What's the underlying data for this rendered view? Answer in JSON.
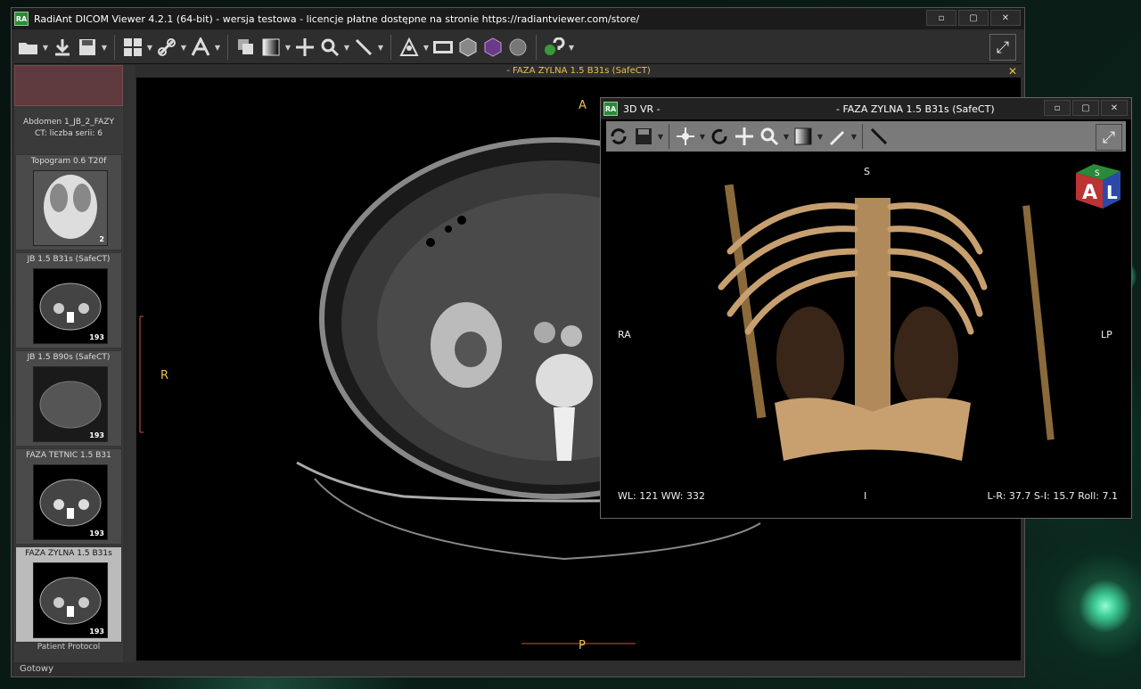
{
  "main": {
    "title": "RadiAnt DICOM Viewer 4.2.1 (64-bit) - wersja testowa - licencje płatne dostępne na stronie https://radiantviewer.com/store/",
    "logo": "RA",
    "window_buttons": [
      "▫",
      "▢",
      "✕"
    ],
    "viewport_header": "- FAZA ZYLNA  1.5  B31s  (SafeCT)",
    "close_glyph": "✕",
    "orientation": {
      "top": "A",
      "left": "R",
      "bottom": "P"
    },
    "status": "Gotowy"
  },
  "sidebar": {
    "study_line1": "Abdomen 1_JB_2_FAZY",
    "study_line2": "CT: liczba serii: 6",
    "series": [
      {
        "label": "Topogram  0.6  T20f",
        "count": "2"
      },
      {
        "label": "JB  1.5  B31s  (SafeCT)",
        "count": "193"
      },
      {
        "label": "JB  1.5  B90s  (SafeCT)",
        "count": "193"
      },
      {
        "label": "FAZA TETNIC  1.5  B31",
        "count": "193"
      },
      {
        "label": "FAZA ZYLNA  1.5  B31s",
        "count": "193"
      }
    ],
    "protocol": "Patient Protocol"
  },
  "toolbar": {
    "icons": [
      "folder-icon",
      "download-icon",
      "save-icon",
      "layout-icon",
      "link-icon",
      "text-icon",
      "series-icon",
      "window-level-icon",
      "pan-icon",
      "zoom-icon",
      "ruler-icon",
      "mpr-icon",
      "cine-icon",
      "mpr3d-icon",
      "3d-icon",
      "fusion-icon",
      "help-icon",
      "fullscreen-icon"
    ],
    "fullscreen_glyph": "⤢"
  },
  "vr": {
    "title": "3D VR -",
    "logo": "RA",
    "series": "- FAZA ZYLNA  1.5  B31s  (SafeCT)",
    "window_buttons": [
      "▫",
      "▢",
      "✕"
    ],
    "orientation": {
      "top": "S",
      "left": "RA",
      "right": "LP",
      "bottom": "I"
    },
    "cube": {
      "top": "S",
      "front": "A",
      "side": "L"
    },
    "wlww": "WL: 121 WW: 332",
    "rotation": "L-R: 37.7 S-I: 15.7 Roll: 7.1"
  },
  "colors": {
    "accent": "#e8c24a",
    "patient": "#5e3a3f"
  }
}
